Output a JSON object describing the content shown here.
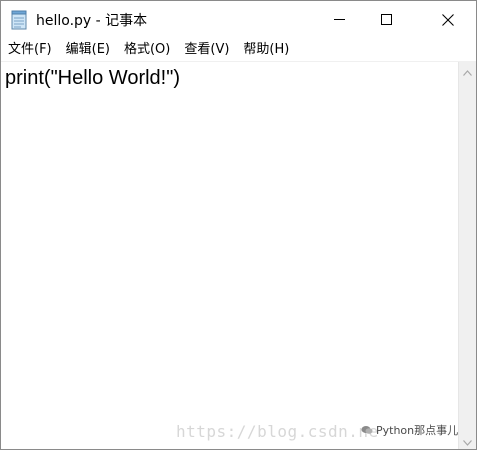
{
  "window": {
    "title": "hello.py - 记事本",
    "app_icon": "notepad-icon",
    "controls": {
      "minimize": "minimize-icon",
      "maximize": "maximize-icon",
      "close": "close-icon"
    }
  },
  "menu": {
    "items": [
      {
        "label": "文件(F)"
      },
      {
        "label": "编辑(E)"
      },
      {
        "label": "格式(O)"
      },
      {
        "label": "查看(V)"
      },
      {
        "label": "帮助(H)"
      }
    ]
  },
  "editor": {
    "content": "print(\"Hello World!\")"
  },
  "watermark": {
    "url": "https://blog.csdn.ne",
    "brand": "Python那点事儿"
  },
  "scrollbar": {
    "up": "chevron-up-icon",
    "down": "chevron-down-icon"
  }
}
